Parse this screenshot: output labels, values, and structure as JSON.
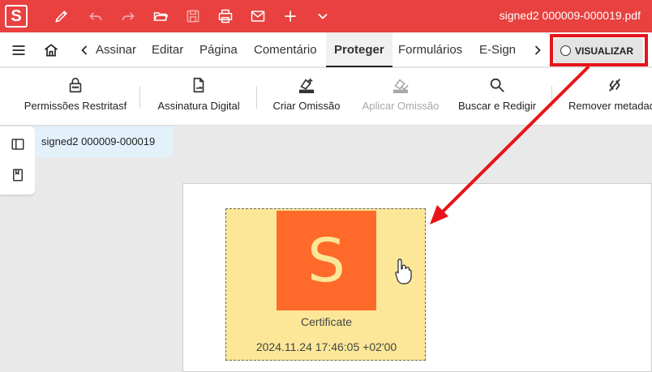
{
  "titlebar": {
    "app_logo": "S",
    "file_title": "signed2 000009-000019.pdf",
    "icons": [
      "pen-icon",
      "undo-icon",
      "redo-icon",
      "open-folder-icon",
      "save-icon",
      "print-icon",
      "mail-icon",
      "add-icon",
      "chevron-down-icon"
    ]
  },
  "menubar": {
    "items": [
      "Assinar",
      "Editar",
      "Página",
      "Comentário",
      "Proteger",
      "Formulários",
      "E-Sign"
    ],
    "active": "Proteger",
    "preview_label": "VISUALIZAR"
  },
  "ribbon": {
    "buttons": [
      {
        "label": "Permissões Restritasf",
        "icon": "lock-icon",
        "enabled": true
      },
      {
        "label": "Assinatura Digital",
        "icon": "digital-signature-icon",
        "enabled": true
      },
      {
        "label": "Criar Omissão",
        "icon": "create-redaction-icon",
        "enabled": true
      },
      {
        "label": "Aplicar Omissão",
        "icon": "apply-redaction-icon",
        "enabled": false
      },
      {
        "label": "Buscar e Redigir",
        "icon": "search-redact-icon",
        "enabled": true
      },
      {
        "label": "Remover metadad",
        "icon": "remove-metadata-icon",
        "enabled": true
      }
    ]
  },
  "document": {
    "tab_name": "signed2 000009-000019",
    "signature": {
      "logo_letter": "S",
      "caption": "Certificate",
      "timestamp": "2024.11.24 17:46:05 +02'00"
    }
  },
  "colors": {
    "brand_red": "#e8413f",
    "highlight_red": "#e8141a",
    "signature_bg": "#fbe797",
    "logo_orange": "#ff6a2a"
  }
}
